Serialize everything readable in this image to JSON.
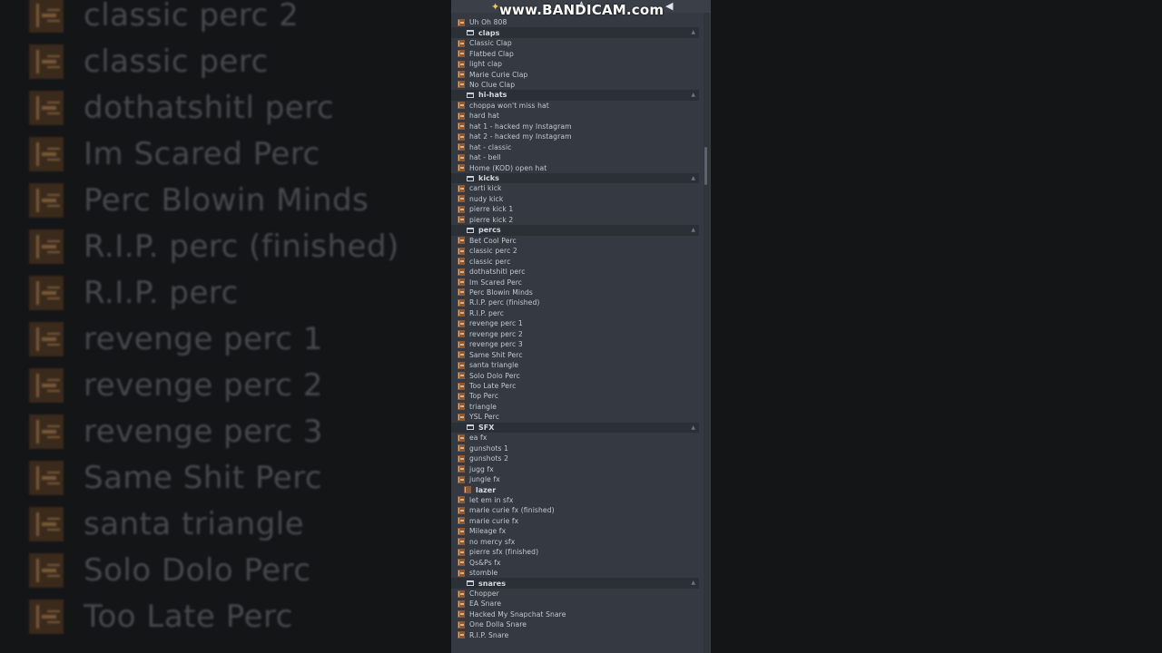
{
  "watermark": {
    "text": "www.BANDICAM.com",
    "left_icon": "sparkle-icon",
    "right_icon": "speaker-icon"
  },
  "background_list": [
    "classic perc 2",
    "classic perc",
    "dothatshitl perc",
    "Im Scared Perc",
    "Perc Blowin Minds",
    "R.I.P. perc (finished)",
    "R.I.P. perc",
    "revenge perc 1",
    "revenge perc 2",
    "revenge perc 3",
    "Same Shit Perc",
    "santa triangle",
    "Solo Dolo Perc",
    "Too Late Perc"
  ],
  "browser": {
    "top_items": [
      "Uh Oh 808"
    ],
    "folders": [
      {
        "name": "claps",
        "items": [
          "Classic Clap",
          "Flatbed Clap",
          "light clap",
          "Marie Curie Clap",
          "No Clue Clap"
        ]
      },
      {
        "name": "hi-hats",
        "items": [
          "choppa won't miss hat",
          "hard hat",
          "hat 1 - hacked my Instagram",
          "hat 2 - hacked my Instagram",
          "hat - classic",
          "hat - bell",
          "Home (KOD) open hat"
        ]
      },
      {
        "name": "kicks",
        "items": [
          "carti kick",
          "nudy kick",
          "pierre kick 1",
          "pierre kick 2"
        ]
      },
      {
        "name": "percs",
        "items": [
          "Bet Cool Perc",
          "classic perc 2",
          "classic perc",
          "dothatshitl perc",
          "Im Scared Perc",
          "Perc Blowin Minds",
          "R.I.P. perc (finished)",
          "R.I.P. perc",
          "revenge perc 1",
          "revenge perc 2",
          "revenge perc 3",
          "Same Shit Perc",
          "santa triangle",
          "Solo Dolo Perc",
          "Too Late Perc",
          "Top Perc",
          "triangle",
          "YSL Perc"
        ]
      },
      {
        "name": "SFX",
        "items": [
          "ea fx",
          "gunshots 1",
          "gunshots 2",
          "jugg fx",
          "jungle fx"
        ],
        "subfolder": "lazer",
        "items_after": [
          "let em in sfx",
          "marie curie fx (finished)",
          "marie curie fx",
          "Mileage fx",
          "no mercy sfx",
          "pierre sfx (finished)",
          "Qs&Ps fx",
          "stomble"
        ]
      },
      {
        "name": "snares",
        "items": [
          "Chopper",
          "EA Snare",
          "Hacked My Snapchat Snare",
          "One Dolla Snare",
          "R.I.P. Snare"
        ]
      }
    ]
  }
}
